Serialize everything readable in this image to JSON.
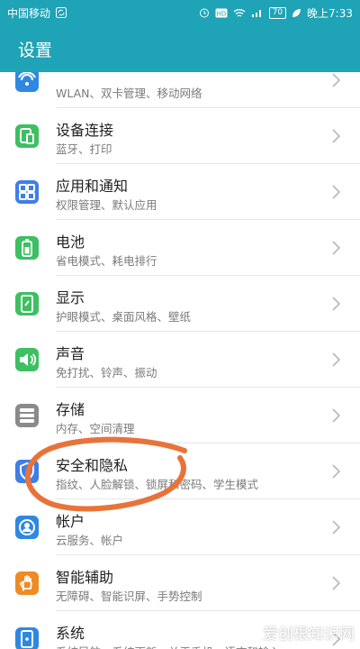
{
  "status_bar": {
    "carrier": "中国移动",
    "battery": "70",
    "time": "晚上7:33",
    "background": "#1fa3b6"
  },
  "title_bar": {
    "title": "设置",
    "background": "#1fa3b6"
  },
  "items": [
    {
      "title": "",
      "subtitle": "WLAN、双卡管理、移动网络",
      "icon": "wifi-icon",
      "color": "#2f88e0"
    },
    {
      "title": "设备连接",
      "subtitle": "蓝牙、打印",
      "icon": "device-connect-icon",
      "color": "#3dbf62"
    },
    {
      "title": "应用和通知",
      "subtitle": "权限管理、默认应用",
      "icon": "apps-icon",
      "color": "#3f7ee8"
    },
    {
      "title": "电池",
      "subtitle": "省电模式、耗电排行",
      "icon": "battery-icon",
      "color": "#3dbf62"
    },
    {
      "title": "显示",
      "subtitle": "护眼模式、桌面风格、壁纸",
      "icon": "display-icon",
      "color": "#3dbf62"
    },
    {
      "title": "声音",
      "subtitle": "免打扰、铃声、振动",
      "icon": "sound-icon",
      "color": "#3dbf62"
    },
    {
      "title": "存储",
      "subtitle": "内存、空间清理",
      "icon": "storage-icon",
      "color": "#8a8a8a"
    },
    {
      "title": "安全和隐私",
      "subtitle": "指纹、人脸解锁、锁屏和密码、学生模式",
      "icon": "shield-icon",
      "color": "#3f7ee8"
    },
    {
      "title": "帐户",
      "subtitle": "云服务、帐户",
      "icon": "account-icon",
      "color": "#2f88e0"
    },
    {
      "title": "智能辅助",
      "subtitle": "无障碍、智能识屏、手势控制",
      "icon": "hand-icon",
      "color": "#f08a24"
    },
    {
      "title": "系统",
      "subtitle": "系统导航、系统更新、关于手机、语言和输入",
      "icon": "system-icon",
      "color": "#2f88e0"
    }
  ],
  "watermark": "爱创根知识网",
  "annotation_color": "#e8733a"
}
